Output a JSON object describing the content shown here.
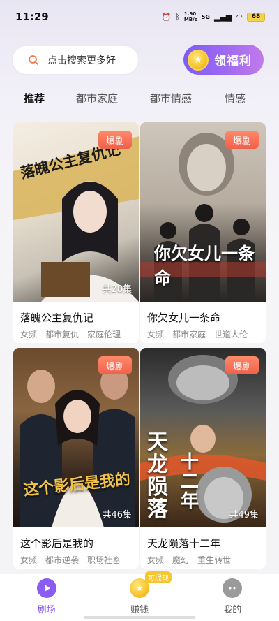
{
  "status": {
    "time": "11:29",
    "net_speed_value": "1.90",
    "net_speed_unit": "MB/s",
    "signal": "5G",
    "battery": "68"
  },
  "search": {
    "placeholder": "点击搜索更多好"
  },
  "reward_button": {
    "label": "领福利"
  },
  "tabs": [
    "推荐",
    "都市家庭",
    "都市情感",
    "情感"
  ],
  "cards": [
    {
      "title": "落魄公主复仇记",
      "badge": "爆剧",
      "episodes": "共28集",
      "tags": [
        "女频",
        "都市复仇",
        "家庭伦理"
      ],
      "poster_text": "落魄公主复仇记"
    },
    {
      "title": "你欠女儿一条命",
      "badge": "爆剧",
      "episodes": "",
      "tags": [
        "女频",
        "都市家庭",
        "世道人伦"
      ],
      "poster_text": "你欠女儿一条命"
    },
    {
      "title": "这个影后是我的",
      "badge": "爆剧",
      "episodes": "共46集",
      "tags": [
        "女频",
        "都市逆袭",
        "职场社畜"
      ],
      "poster_text": "这个影后是我的"
    },
    {
      "title": "天龙陨落十二年",
      "badge": "爆剧",
      "episodes": "共49集",
      "tags": [
        "女频",
        "魔幻",
        "重生转世"
      ],
      "poster_text": "天龙陨落十二年"
    }
  ],
  "bottom_nav": {
    "items": [
      {
        "label": "剧场",
        "icon": "play-icon",
        "active": true
      },
      {
        "label": "赚钱",
        "icon": "coin-icon",
        "active": false
      },
      {
        "label": "我的",
        "icon": "profile-icon",
        "active": false
      }
    ],
    "withdraw_tag": "可提现"
  },
  "colors": {
    "accent": "#8a5cf0",
    "badge": "#f0604b",
    "coin": "#f7c52c"
  }
}
